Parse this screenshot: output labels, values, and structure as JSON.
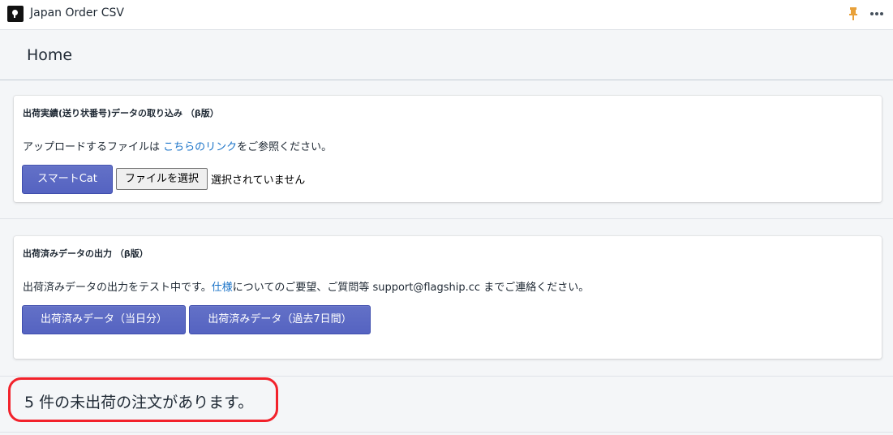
{
  "app": {
    "title": "Japan Order CSV",
    "pin_icon": "pin-icon",
    "more_icon": "more-horizontal-icon"
  },
  "page": {
    "title": "Home"
  },
  "import_card": {
    "title": "出荷実績(送り状番号)データの取り込み （β版）",
    "text_before": "アップロードするファイルは ",
    "link": "こちらのリンク",
    "text_after": "をご参照ください。",
    "button": "スマートCat",
    "file_button": "ファイルを選択",
    "file_status": "選択されていません"
  },
  "export_card": {
    "title": "出荷済みデータの出力 （β版）",
    "text_before": "出荷済みデータの出力をテスト中です。",
    "link": "仕様",
    "text_after": "についてのご要望、ご質問等 support@flagship.cc までご連絡ください。",
    "button_today": "出荷済みデータ（当日分）",
    "button_week": "出荷済みデータ（過去7日間）"
  },
  "status": {
    "unshipped": "5 件の未出荷の注文があります。"
  },
  "colors": {
    "primary": "#5c6ac4",
    "link": "#1a73c8",
    "highlight": "#f2222b",
    "pin": "#e8a13a"
  }
}
